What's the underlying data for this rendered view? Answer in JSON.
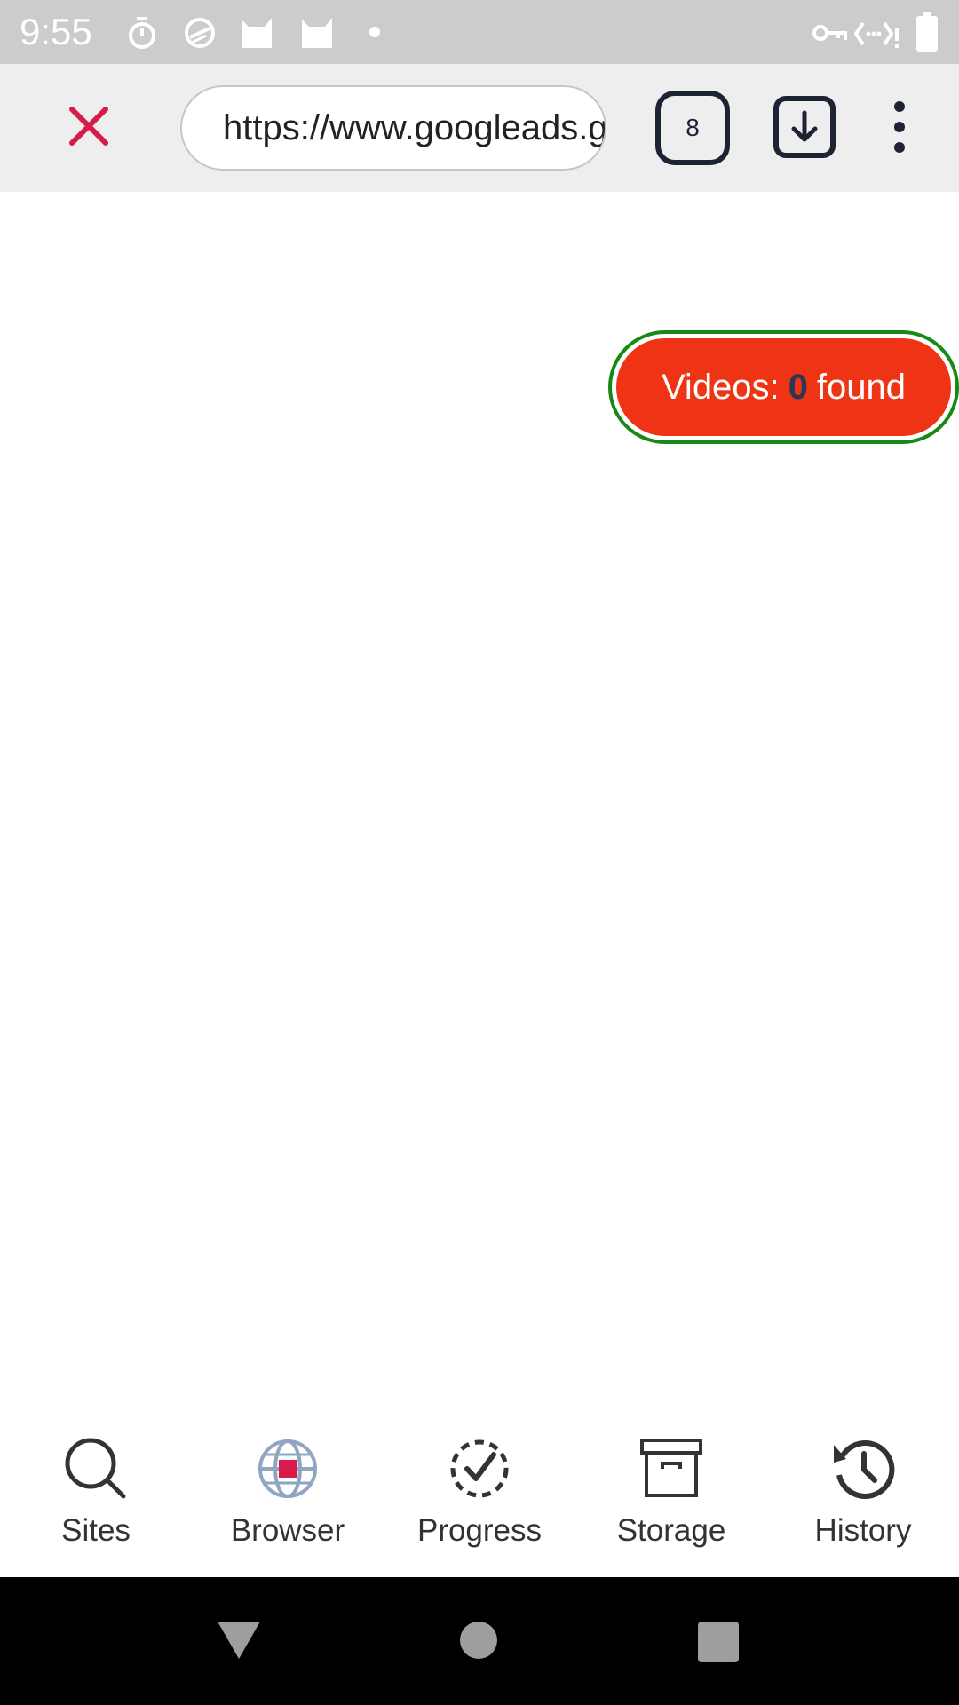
{
  "status_bar": {
    "time": "9:55",
    "icons": [
      "stopwatch-icon",
      "data-saver-icon",
      "cat-icon",
      "cat-icon",
      "dot-icon",
      "vpn-key-icon",
      "data-icon",
      "battery-icon"
    ],
    "background": "#cccccc"
  },
  "toolbar": {
    "url": "https://www.googleads.g.doubleclick.net",
    "tab_count": "8",
    "close_icon": "close-icon",
    "download_icon": "download-icon",
    "menu_icon": "more-vert-icon",
    "accent": "#d81b4b"
  },
  "videos_badge": {
    "prefix": "Videos:",
    "count": "0",
    "suffix": "found",
    "background": "#ee3414",
    "border": "#168a14"
  },
  "bottom_nav": {
    "items": [
      {
        "label": "Sites",
        "icon": "search-icon"
      },
      {
        "label": "Browser",
        "icon": "globe-icon"
      },
      {
        "label": "Progress",
        "icon": "progress-check-icon"
      },
      {
        "label": "Storage",
        "icon": "archive-icon"
      },
      {
        "label": "History",
        "icon": "history-icon"
      }
    ]
  },
  "system_nav": {
    "buttons": [
      "back-button",
      "home-button",
      "recents-button"
    ]
  }
}
